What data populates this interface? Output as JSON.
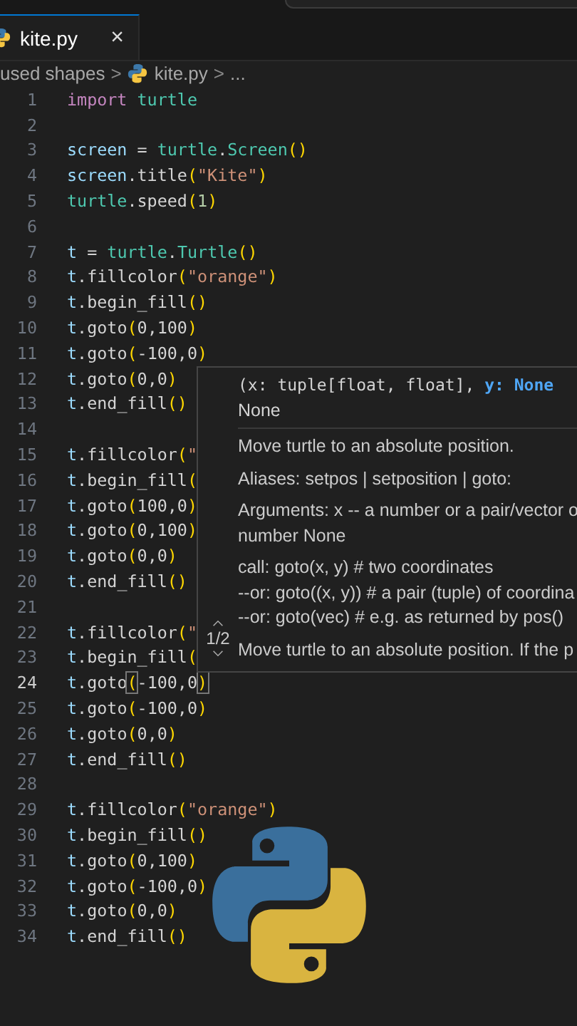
{
  "tab": {
    "label": "kite.py",
    "close": "×",
    "selected": true
  },
  "breadcrumb": {
    "folder": "used shapes",
    "sep1": ">",
    "file": "kite.py",
    "sep2": ">",
    "more": "..."
  },
  "lines": [
    {
      "number": "1",
      "current": false,
      "tokens": [
        {
          "text": "import ",
          "kind": "kw"
        },
        {
          "text": "turtle",
          "kind": "mod"
        }
      ]
    },
    {
      "number": "2",
      "current": false
    },
    {
      "number": "3",
      "current": false,
      "tokens": [
        {
          "text": "screen",
          "kind": "var"
        },
        {
          "text": " = ",
          "kind": "p"
        },
        {
          "text": "turtle",
          "kind": "mod"
        },
        {
          "text": ".",
          "kind": "p"
        },
        {
          "text": "Screen",
          "kind": "mod"
        },
        {
          "text": "()",
          "kind": "br"
        }
      ]
    },
    {
      "number": "4",
      "current": false,
      "tokens": [
        {
          "text": "screen",
          "kind": "var"
        },
        {
          "text": ".title",
          "kind": "p"
        },
        {
          "text": "(",
          "kind": "br"
        },
        {
          "text": "\"Kite\"",
          "kind": "str"
        },
        {
          "text": ")",
          "kind": "br"
        }
      ]
    },
    {
      "number": "5",
      "current": false,
      "tokens": [
        {
          "text": "turtle",
          "kind": "mod"
        },
        {
          "text": ".speed",
          "kind": "p"
        },
        {
          "text": "(",
          "kind": "br"
        },
        {
          "text": "1",
          "kind": "num"
        },
        {
          "text": ")",
          "kind": "br"
        }
      ]
    },
    {
      "number": "6",
      "current": false
    },
    {
      "number": "7",
      "current": false,
      "tokens": [
        {
          "text": "t",
          "kind": "var"
        },
        {
          "text": " = ",
          "kind": "p"
        },
        {
          "text": "turtle",
          "kind": "mod"
        },
        {
          "text": ".",
          "kind": "p"
        },
        {
          "text": "Turtle",
          "kind": "mod"
        },
        {
          "text": "()",
          "kind": "br"
        }
      ]
    },
    {
      "number": "8",
      "current": false,
      "tokens": [
        {
          "text": "t",
          "kind": "var"
        },
        {
          "text": ".fillcolor",
          "kind": "p"
        },
        {
          "text": "(",
          "kind": "br"
        },
        {
          "text": "\"orange\"",
          "kind": "str"
        },
        {
          "text": ")",
          "kind": "br"
        }
      ]
    },
    {
      "number": "9",
      "current": false,
      "tokens": [
        {
          "text": "t",
          "kind": "var"
        },
        {
          "text": ".begin_fill",
          "kind": "p"
        },
        {
          "text": "()",
          "kind": "br"
        }
      ]
    },
    {
      "number": "10",
      "current": false,
      "tokens": [
        {
          "text": "t",
          "kind": "var"
        },
        {
          "text": ".goto",
          "kind": "p"
        },
        {
          "text": "(",
          "kind": "br"
        },
        {
          "text": "0,100",
          "kind": "p"
        },
        {
          "text": ")",
          "kind": "br"
        }
      ]
    },
    {
      "number": "11",
      "current": false,
      "tokens": [
        {
          "text": "t",
          "kind": "var"
        },
        {
          "text": ".goto",
          "kind": "p"
        },
        {
          "text": "(",
          "kind": "br"
        },
        {
          "text": "-100,0",
          "kind": "p"
        },
        {
          "text": ")",
          "kind": "br"
        }
      ]
    },
    {
      "number": "12",
      "current": false,
      "tokens": [
        {
          "text": "t",
          "kind": "var"
        },
        {
          "text": ".goto",
          "kind": "p"
        },
        {
          "text": "(",
          "kind": "br"
        },
        {
          "text": "0,0",
          "kind": "p"
        },
        {
          "text": ")",
          "kind": "br"
        }
      ]
    },
    {
      "number": "13",
      "current": false,
      "tokens": [
        {
          "text": "t",
          "kind": "var"
        },
        {
          "text": ".end_fill",
          "kind": "p"
        },
        {
          "text": "()",
          "kind": "br"
        }
      ]
    },
    {
      "number": "14",
      "current": false
    },
    {
      "number": "15",
      "current": false,
      "tokens": [
        {
          "text": "t",
          "kind": "var"
        },
        {
          "text": ".fillcolor",
          "kind": "p"
        },
        {
          "text": "(",
          "kind": "br"
        },
        {
          "text": "\"",
          "kind": "str"
        }
      ]
    },
    {
      "number": "16",
      "current": false,
      "tokens": [
        {
          "text": "t",
          "kind": "var"
        },
        {
          "text": ".begin_fill",
          "kind": "p"
        },
        {
          "text": "(",
          "kind": "br"
        }
      ]
    },
    {
      "number": "17",
      "current": false,
      "tokens": [
        {
          "text": "t",
          "kind": "var"
        },
        {
          "text": ".goto",
          "kind": "p"
        },
        {
          "text": "(",
          "kind": "br"
        },
        {
          "text": "100,0",
          "kind": "p"
        },
        {
          "text": ")",
          "kind": "br"
        }
      ]
    },
    {
      "number": "18",
      "current": false,
      "tokens": [
        {
          "text": "t",
          "kind": "var"
        },
        {
          "text": ".goto",
          "kind": "p"
        },
        {
          "text": "(",
          "kind": "br"
        },
        {
          "text": "0,100",
          "kind": "p"
        },
        {
          "text": ")",
          "kind": "br"
        }
      ]
    },
    {
      "number": "19",
      "current": false,
      "tokens": [
        {
          "text": "t",
          "kind": "var"
        },
        {
          "text": ".goto",
          "kind": "p"
        },
        {
          "text": "(",
          "kind": "br"
        },
        {
          "text": "0,0",
          "kind": "p"
        },
        {
          "text": ")",
          "kind": "br"
        }
      ]
    },
    {
      "number": "20",
      "current": false,
      "tokens": [
        {
          "text": "t",
          "kind": "var"
        },
        {
          "text": ".end_fill",
          "kind": "p"
        },
        {
          "text": "()",
          "kind": "br"
        }
      ]
    },
    {
      "number": "21",
      "current": false
    },
    {
      "number": "22",
      "current": false,
      "tokens": [
        {
          "text": "t",
          "kind": "var"
        },
        {
          "text": ".fillcolor",
          "kind": "p"
        },
        {
          "text": "(",
          "kind": "br"
        },
        {
          "text": "\"",
          "kind": "str"
        }
      ]
    },
    {
      "number": "23",
      "current": false,
      "tokens": [
        {
          "text": "t",
          "kind": "var"
        },
        {
          "text": ".begin_fill",
          "kind": "p"
        },
        {
          "text": "(",
          "kind": "br"
        }
      ]
    },
    {
      "number": "24",
      "current": true,
      "tokens": [
        {
          "text": "t",
          "kind": "var"
        },
        {
          "text": ".goto",
          "kind": "p"
        },
        {
          "text": "(",
          "kind": "match"
        },
        {
          "text": "-100,0",
          "kind": "p"
        },
        {
          "text": ")",
          "kind": "match"
        }
      ]
    },
    {
      "number": "25",
      "current": false,
      "tokens": [
        {
          "text": "t",
          "kind": "var"
        },
        {
          "text": ".goto",
          "kind": "p"
        },
        {
          "text": "(",
          "kind": "br"
        },
        {
          "text": "-100,0",
          "kind": "p"
        },
        {
          "text": ")",
          "kind": "br"
        }
      ]
    },
    {
      "number": "26",
      "current": false,
      "tokens": [
        {
          "text": "t",
          "kind": "var"
        },
        {
          "text": ".goto",
          "kind": "p"
        },
        {
          "text": "(",
          "kind": "br"
        },
        {
          "text": "0,0",
          "kind": "p"
        },
        {
          "text": ")",
          "kind": "br"
        }
      ]
    },
    {
      "number": "27",
      "current": false,
      "tokens": [
        {
          "text": "t",
          "kind": "var"
        },
        {
          "text": ".end_fill",
          "kind": "p"
        },
        {
          "text": "()",
          "kind": "br"
        }
      ]
    },
    {
      "number": "28",
      "current": false
    },
    {
      "number": "29",
      "current": false,
      "tokens": [
        {
          "text": "t",
          "kind": "var"
        },
        {
          "text": ".fillcolor",
          "kind": "p"
        },
        {
          "text": "(",
          "kind": "br"
        },
        {
          "text": "\"orange\"",
          "kind": "str"
        },
        {
          "text": ")",
          "kind": "br"
        }
      ]
    },
    {
      "number": "30",
      "current": false,
      "tokens": [
        {
          "text": "t",
          "kind": "var"
        },
        {
          "text": ".begin_fill",
          "kind": "p"
        },
        {
          "text": "()",
          "kind": "br"
        }
      ]
    },
    {
      "number": "31",
      "current": false,
      "tokens": [
        {
          "text": "t",
          "kind": "var"
        },
        {
          "text": ".goto",
          "kind": "p"
        },
        {
          "text": "(",
          "kind": "br"
        },
        {
          "text": "0,100",
          "kind": "p"
        },
        {
          "text": ")",
          "kind": "br"
        }
      ]
    },
    {
      "number": "32",
      "current": false,
      "tokens": [
        {
          "text": "t",
          "kind": "var"
        },
        {
          "text": ".goto",
          "kind": "p"
        },
        {
          "text": "(",
          "kind": "br"
        },
        {
          "text": "-100,0",
          "kind": "p"
        },
        {
          "text": ")",
          "kind": "br"
        }
      ]
    },
    {
      "number": "33",
      "current": false,
      "tokens": [
        {
          "text": "t",
          "kind": "var"
        },
        {
          "text": ".goto",
          "kind": "p"
        },
        {
          "text": "(",
          "kind": "br"
        },
        {
          "text": "0,0",
          "kind": "p"
        },
        {
          "text": ")",
          "kind": "br"
        }
      ]
    },
    {
      "number": "34",
      "current": false,
      "tokens": [
        {
          "text": "t",
          "kind": "var"
        },
        {
          "text": ".end_fill",
          "kind": "p"
        },
        {
          "text": "()",
          "kind": "br"
        }
      ]
    }
  ],
  "hover": {
    "signature": [
      {
        "text": "(x: tuple[float, float], ",
        "kind": "p"
      },
      {
        "text": "y: None",
        "kind": "param"
      }
    ],
    "returns": "None",
    "paragraphs": [
      [
        "Move turtle to an absolute position."
      ],
      [
        "Aliases: setpos | setposition | goto:"
      ],
      [
        "Arguments: x -- a number or a pair/vector o",
        "number None"
      ],
      [
        "call: goto(x, y) # two coordinates",
        "--or: goto((x, y)) # a pair (tuple) of coordina",
        "--or: goto(vec) # e.g. as returned by pos()"
      ],
      [
        "Move turtle to an absolute position. If the p"
      ]
    ],
    "counter": "1/2"
  }
}
